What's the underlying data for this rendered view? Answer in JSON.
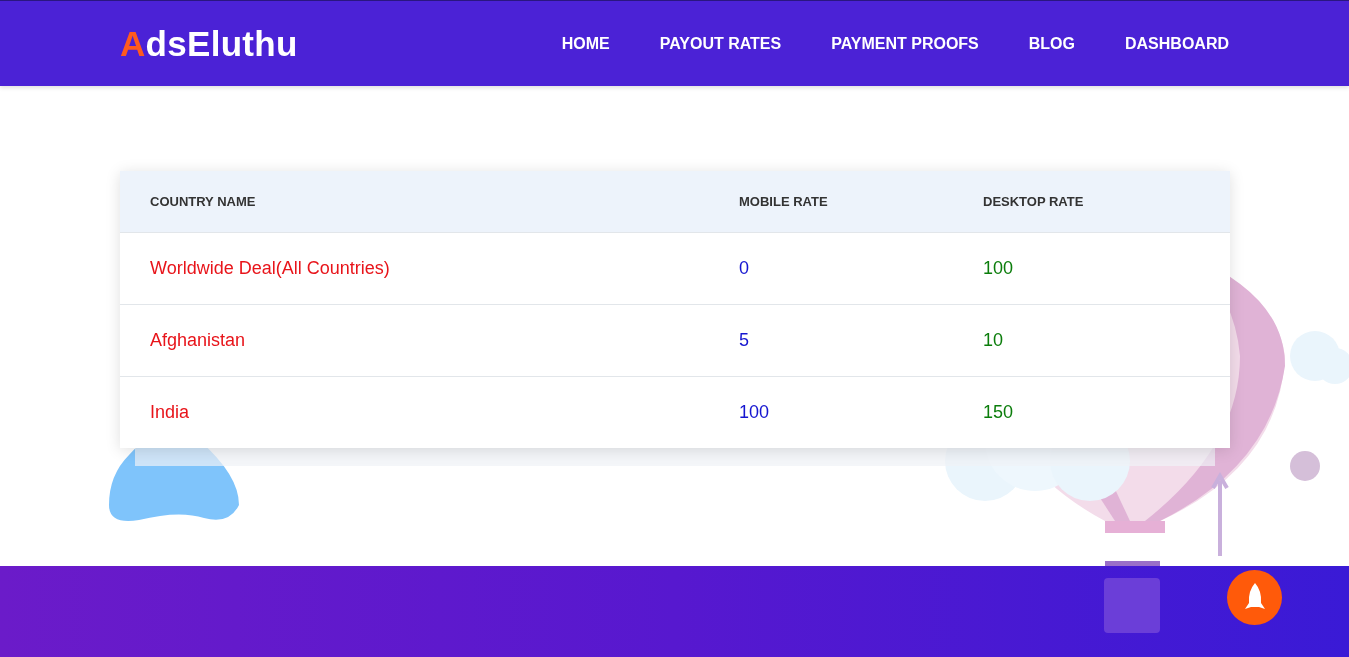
{
  "header": {
    "logo": {
      "initial": "A",
      "rest": "dsEluthu"
    },
    "nav": [
      {
        "label": "HOME"
      },
      {
        "label": "PAYOUT RATES"
      },
      {
        "label": "PAYMENT PROOFS"
      },
      {
        "label": "BLOG"
      },
      {
        "label": "DASHBOARD"
      }
    ]
  },
  "table": {
    "columns": [
      "COUNTRY NAME",
      "MOBILE RATE",
      "DESKTOP RATE"
    ],
    "rows": [
      [
        "Worldwide Deal(All Countries)",
        "0",
        "100"
      ],
      [
        "Afghanistan",
        "5",
        "10"
      ],
      [
        "India",
        "100",
        "150"
      ]
    ]
  }
}
